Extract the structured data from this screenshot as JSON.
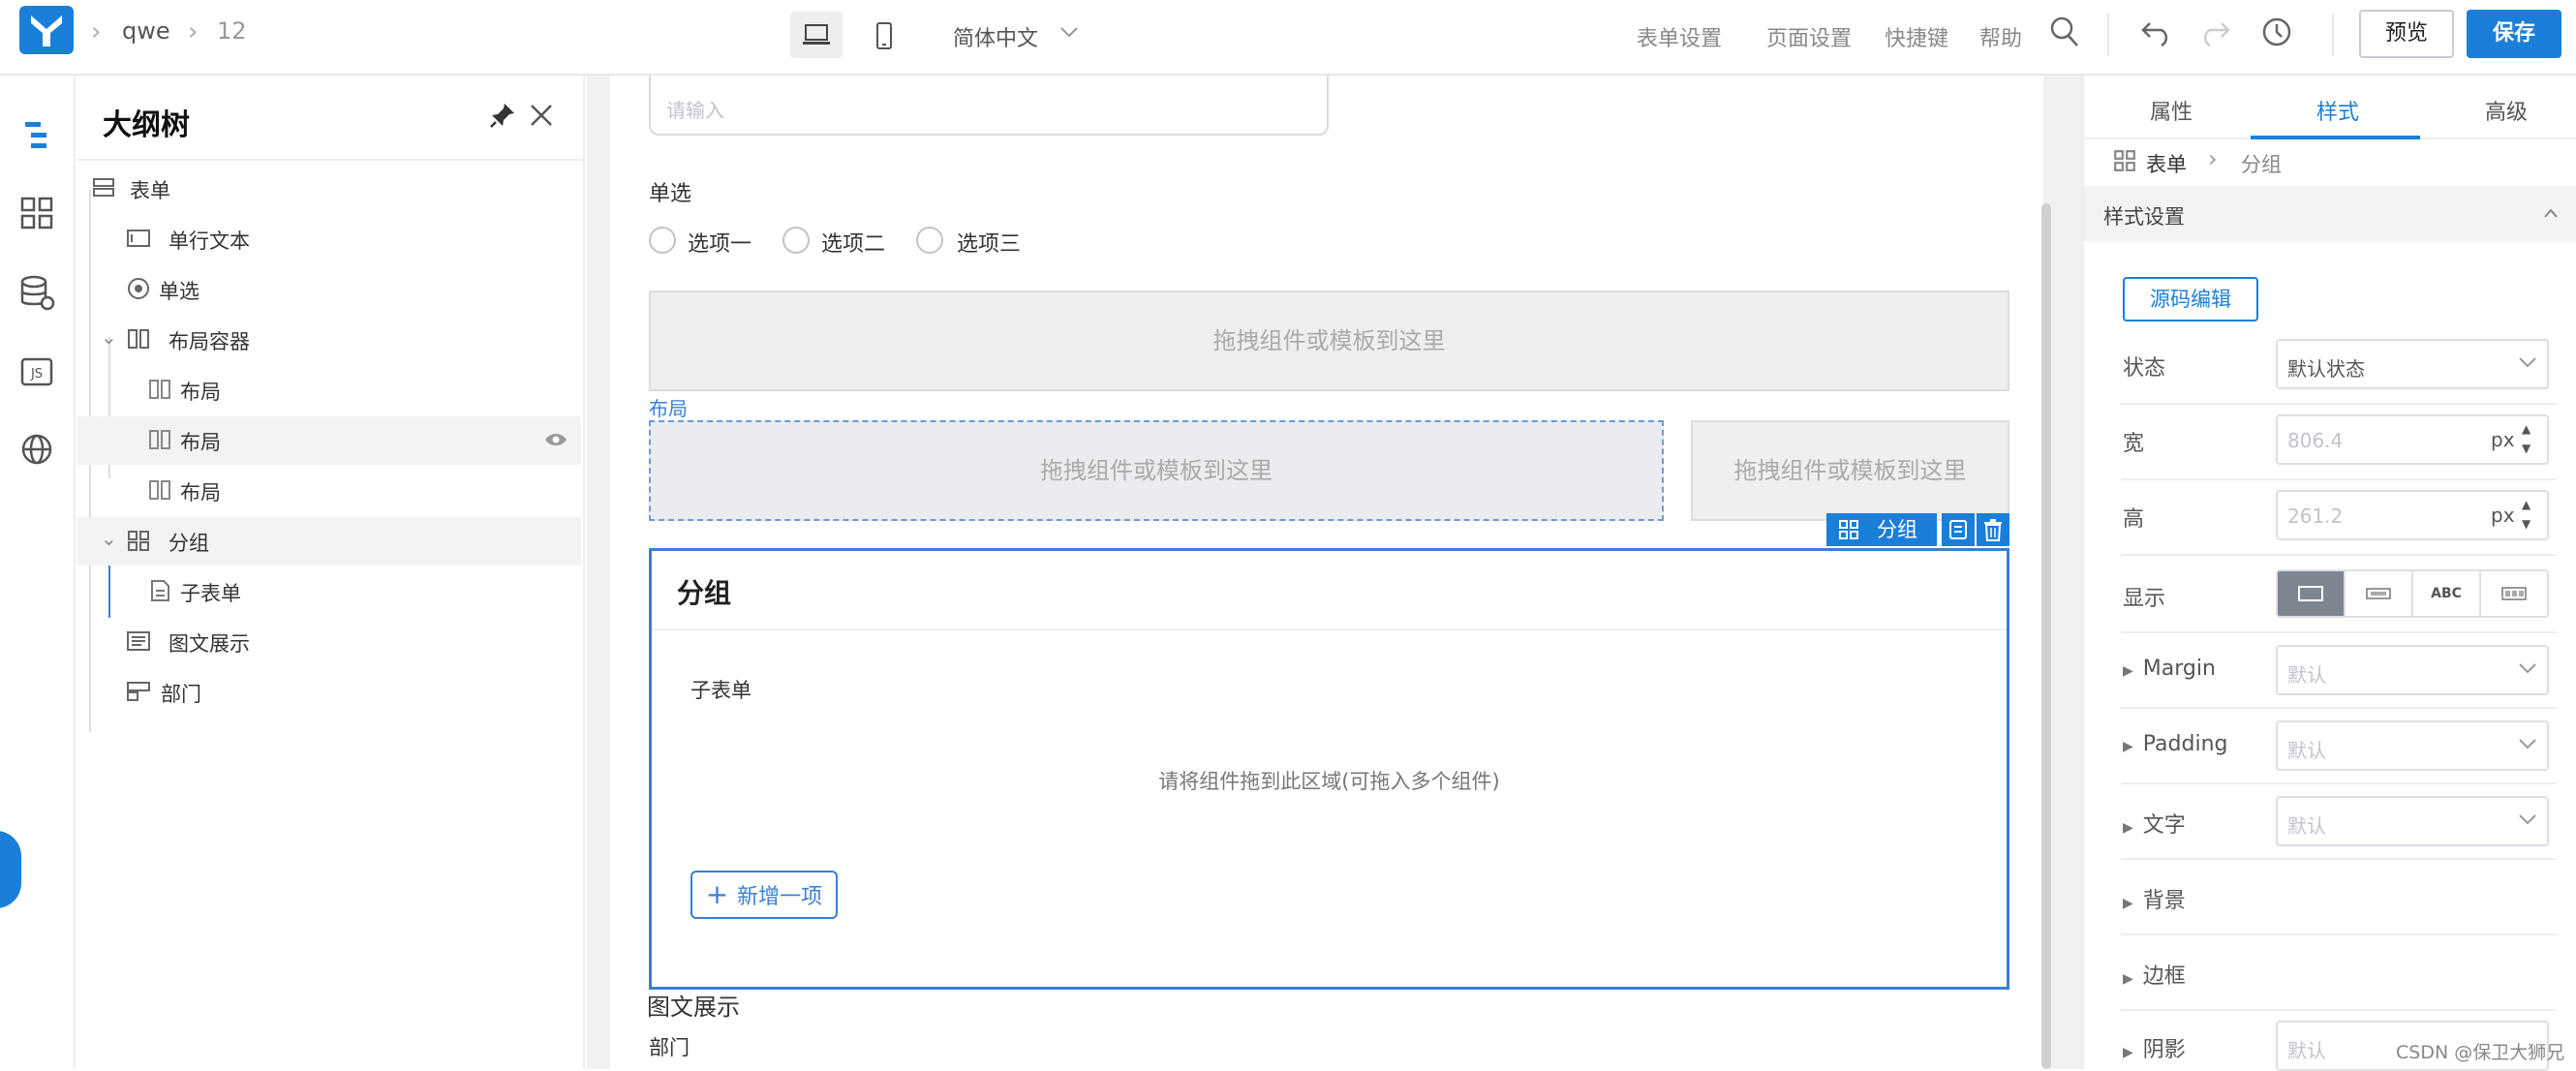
{
  "topbar": {
    "crumbs": [
      "qwe",
      "12"
    ],
    "lang": "简体中文",
    "links": [
      "表单设置",
      "页面设置",
      "快捷键",
      "帮助"
    ],
    "preview": "预览",
    "save": "保存"
  },
  "outline": {
    "title": "大纲树",
    "items": [
      {
        "label": "表单",
        "icon": "form-icon",
        "level": 0
      },
      {
        "label": "单行文本",
        "icon": "textfield-icon",
        "level": 1
      },
      {
        "label": "单选",
        "icon": "radio-icon",
        "level": 1
      },
      {
        "label": "布局容器",
        "icon": "layout-container-icon",
        "level": 1
      },
      {
        "label": "布局",
        "icon": "column-icon",
        "level": 2
      },
      {
        "label": "布局",
        "icon": "column-icon",
        "level": 2
      },
      {
        "label": "布局",
        "icon": "column-icon",
        "level": 2
      },
      {
        "label": "分组",
        "icon": "group-icon",
        "level": 1
      },
      {
        "label": "子表单",
        "icon": "subform-icon",
        "level": 2
      },
      {
        "label": "图文展示",
        "icon": "richtext-icon",
        "level": 1
      },
      {
        "label": "部门",
        "icon": "department-icon",
        "level": 1
      }
    ]
  },
  "canvas": {
    "input_placeholder": "请输入",
    "radio_label": "单选",
    "radio_options": [
      "选项一",
      "选项二",
      "选项三"
    ],
    "drop_text": "拖拽组件或模板到这里",
    "layout_label": "布局",
    "group_tag": "分组",
    "group_title": "分组",
    "subform_label": "子表单",
    "subform_hint": "请将组件拖到此区域(可拖入多个组件)",
    "add_item": "新增一项",
    "richtext_label": "图文展示",
    "dept_label": "部门"
  },
  "props": {
    "tabs": [
      "属性",
      "样式",
      "高级"
    ],
    "breadcrumb": [
      "表单",
      "分组"
    ],
    "section": "样式设置",
    "source_edit": "源码编辑",
    "state_label": "状态",
    "state_value": "默认状态",
    "width_label": "宽",
    "width_value": "806.4",
    "height_label": "高",
    "height_value": "261.2",
    "unit": "px",
    "display_label": "显示",
    "display_abc": "ABC",
    "margin_label": "Margin",
    "padding_label": "Padding",
    "text_label": "文字",
    "bg_label": "背景",
    "border_label": "边框",
    "shadow_label": "阴影",
    "default_ph": "默认"
  },
  "colors": {
    "accent": "#1a7fd9",
    "selection": "#3a7fd5"
  },
  "watermark": "CSDN @保卫大狮兄"
}
